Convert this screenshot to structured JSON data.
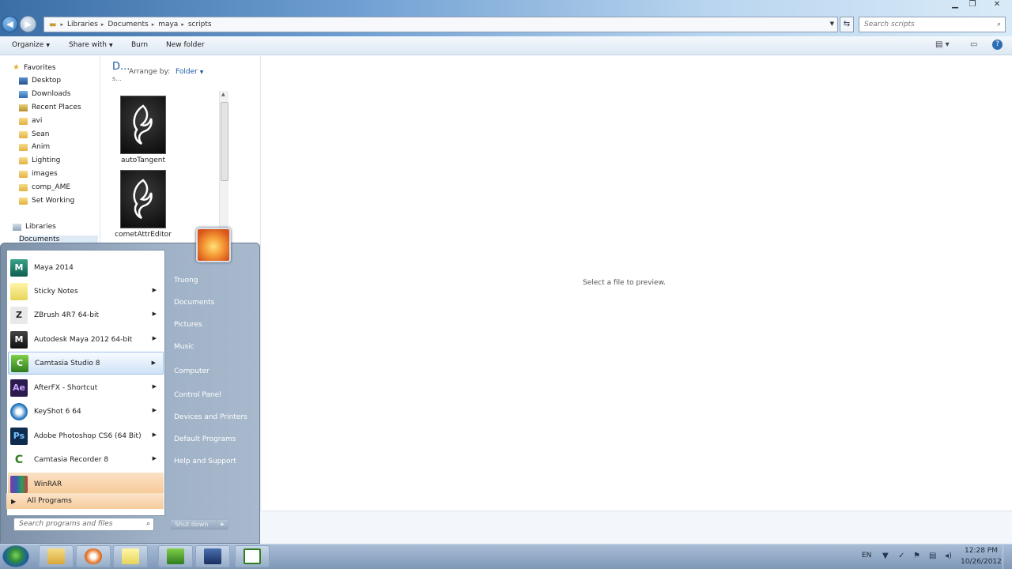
{
  "explorer": {
    "breadcrumbs": [
      "Libraries",
      "Documents",
      "maya",
      "scripts"
    ],
    "search_placeholder": "Search scripts",
    "commands": {
      "organize": "Organize",
      "share_with": "Share with",
      "burn": "Burn",
      "new_folder": "New folder"
    },
    "nav": {
      "favorites_label": "Favorites",
      "favorites": [
        "Desktop",
        "Downloads",
        "Recent Places",
        "avi",
        "Sean",
        "Anim",
        "Lighting",
        "images",
        "comp_AME",
        "Set Working"
      ],
      "libraries_label": "Libraries",
      "libraries": [
        "Documents"
      ]
    },
    "files_header": "D...",
    "files_subheader": "s...",
    "arrange_by_label": "Arrange by:",
    "arrange_by_value": "Folder",
    "files": [
      {
        "name": "autoTangent",
        "icon": "maya-script-icon"
      },
      {
        "name": "cometAttrEditor",
        "icon": "maya-script-icon"
      }
    ],
    "preview_message": "Select a file to preview."
  },
  "start_menu": {
    "programs": [
      {
        "label": "Maya 2014",
        "icon": "maya-2014-icon",
        "has_submenu": false
      },
      {
        "label": "Sticky Notes",
        "icon": "sticky-notes-icon",
        "has_submenu": true
      },
      {
        "label": "ZBrush 4R7 64-bit",
        "icon": "zbrush-icon",
        "has_submenu": true
      },
      {
        "label": "Autodesk Maya 2012 64-bit",
        "icon": "maya-2012-icon",
        "has_submenu": true
      },
      {
        "label": "Camtasia Studio 8",
        "icon": "camtasia-studio-icon",
        "has_submenu": true
      },
      {
        "label": "AfterFX - Shortcut",
        "icon": "after-effects-icon",
        "has_submenu": true
      },
      {
        "label": "KeyShot 6 64",
        "icon": "keyshot-icon",
        "has_submenu": true
      },
      {
        "label": "Adobe Photoshop CS6 (64 Bit)",
        "icon": "photoshop-icon",
        "has_submenu": true
      },
      {
        "label": "Camtasia Recorder 8",
        "icon": "camtasia-recorder-icon",
        "has_submenu": true
      },
      {
        "label": "WinRAR",
        "icon": "winrar-icon",
        "has_submenu": false
      }
    ],
    "all_programs": "All Programs",
    "search_placeholder": "Search programs and files",
    "right_links": [
      "Truong",
      "Documents",
      "Pictures",
      "Music",
      "Computer",
      "Control Panel",
      "Devices and Printers",
      "Default Programs",
      "Help and Support"
    ],
    "shutdown": "Shut down"
  },
  "taskbar": {
    "language": "EN",
    "time": "12:28 PM",
    "date": "10/26/2012",
    "apps": [
      "file-explorer-icon",
      "media-player-icon",
      "sticky-notes-icon",
      "camtasia-studio-icon",
      "video-editor-icon",
      "camtasia-recorder-icon"
    ]
  }
}
